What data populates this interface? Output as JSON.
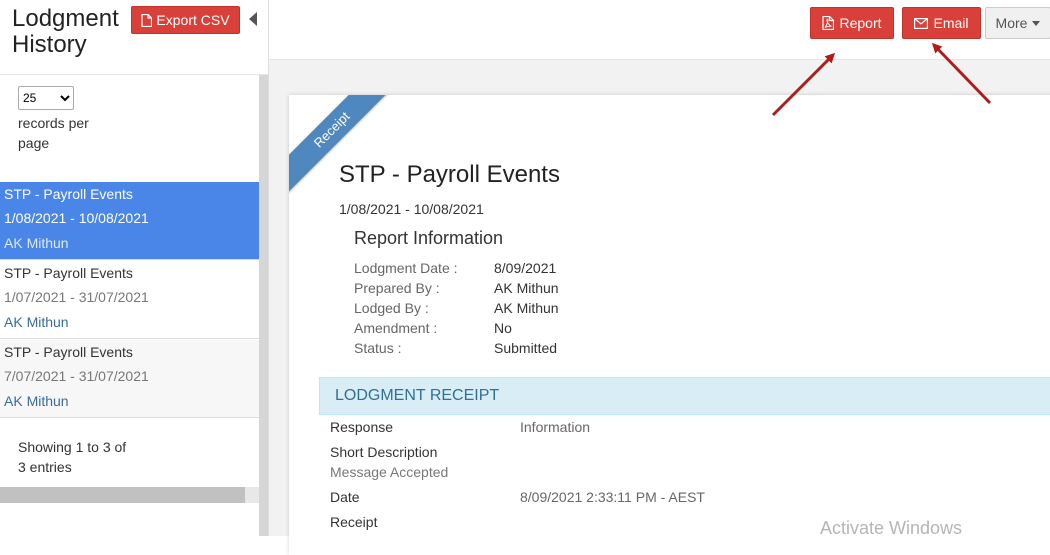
{
  "sidebar": {
    "title": "Lodgment History",
    "export_label": "Export CSV",
    "per_page_value": "25",
    "per_page_label": "records per page",
    "items": [
      {
        "title": "STP - Payroll Events",
        "dates": "1/08/2021 - 10/08/2021",
        "user": "AK Mithun",
        "state": "selected"
      },
      {
        "title": "STP - Payroll Events",
        "dates": "1/07/2021 - 31/07/2021",
        "user": "AK Mithun",
        "state": ""
      },
      {
        "title": "STP - Payroll Events",
        "dates": "7/07/2021 - 31/07/2021",
        "user": "AK Mithun",
        "state": ""
      }
    ],
    "showing_text": "Showing 1 to 3 of 3 entries"
  },
  "toolbar": {
    "report_label": "Report",
    "email_label": "Email",
    "more_label": "More"
  },
  "document": {
    "ribbon": "Receipt",
    "title": "STP - Payroll Events",
    "dates": "1/08/2021 - 10/08/2021",
    "report_info_heading": "Report Information",
    "info": [
      {
        "key": "Lodgment Date :",
        "value": "8/09/2021"
      },
      {
        "key": "Prepared By :",
        "value": "AK Mithun"
      },
      {
        "key": "Lodged By :",
        "value": "AK Mithun"
      },
      {
        "key": "Amendment :",
        "value": "No"
      },
      {
        "key": "Status :",
        "value": "Submitted"
      }
    ],
    "receipt_heading": "LODGMENT RECEIPT",
    "receipt": {
      "response_label": "Response",
      "response_value": "Information",
      "short_desc_label": "Short Description",
      "short_desc_value": "Message Accepted",
      "date_label": "Date",
      "date_value": "8/09/2021 2:33:11 PM - AEST",
      "receipt_label": "Receipt"
    }
  },
  "watermark": "Activate Windows",
  "colors": {
    "danger": "#d9403a",
    "selected": "#4a86e8",
    "annotation_arrow": "#b01c1c",
    "receipt_band": "#d9edf7"
  }
}
